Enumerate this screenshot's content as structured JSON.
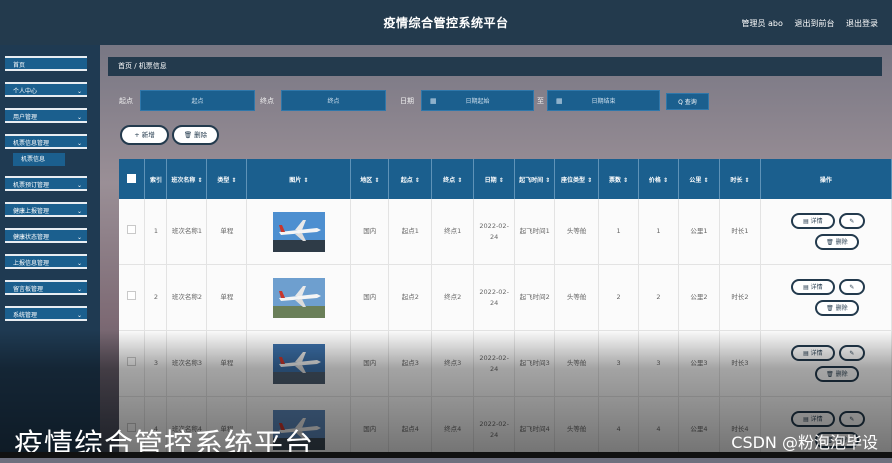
{
  "header": {
    "title": "疫情综合管控系统平台",
    "admin": "管理员 abo",
    "back": "退出到前台",
    "logout": "退出登录"
  },
  "sidebar": {
    "items": [
      {
        "label": "首页",
        "chevron": ""
      },
      {
        "label": "个人中心",
        "chevron": "⌄"
      },
      {
        "label": "用户管理",
        "chevron": "⌄"
      },
      {
        "label": "机票信息管理",
        "chevron": "⌄"
      },
      {
        "label": "机票预订管理",
        "chevron": "⌄"
      },
      {
        "label": "健康上报管理",
        "chevron": "⌄"
      },
      {
        "label": "健康状态管理",
        "chevron": "⌄"
      },
      {
        "label": "上报信息管理",
        "chevron": "⌄"
      },
      {
        "label": "留言板管理",
        "chevron": "⌄"
      },
      {
        "label": "系统管理",
        "chevron": "⌄"
      }
    ],
    "subitem": "机票信息"
  },
  "breadcrumb": "首页 / 机票信息",
  "search": {
    "from_label": "起点",
    "from_placeholder": "起点",
    "to_label": "终点",
    "to_placeholder": "终点",
    "date_label": "日期",
    "date_start": "日期起始",
    "range_sep": "至",
    "date_end": "日期结束",
    "query": "Q 查询"
  },
  "toolbar": {
    "add": "+ 新增",
    "delete": "🗑 删除"
  },
  "table": {
    "headers": [
      "",
      "索引",
      "班次名称 ⇕",
      "类型 ⇕",
      "图片 ⇕",
      "地区 ⇕",
      "起点 ⇕",
      "终点 ⇕",
      "日期 ⇕",
      "起飞时间 ⇕",
      "座位类型 ⇕",
      "票数 ⇕",
      "价格 ⇕",
      "公里 ⇕",
      "时长 ⇕",
      "操作"
    ],
    "rows": [
      {
        "idx": "1",
        "name": "班次名称1",
        "type": "单程",
        "region": "国内",
        "from": "起点1",
        "to": "终点1",
        "date": "2022-02-24",
        "time": "起飞时间1",
        "seat": "头等舱",
        "tickets": "1",
        "price": "1",
        "km": "公里1",
        "dur": "时长1"
      },
      {
        "idx": "2",
        "name": "班次名称2",
        "type": "单程",
        "region": "国内",
        "from": "起点2",
        "to": "终点2",
        "date": "2022-02-24",
        "time": "起飞时间2",
        "seat": "头等舱",
        "tickets": "2",
        "price": "2",
        "km": "公里2",
        "dur": "时长2"
      },
      {
        "idx": "3",
        "name": "班次名称3",
        "type": "单程",
        "region": "国内",
        "from": "起点3",
        "to": "终点3",
        "date": "2022-02-24",
        "time": "起飞时间3",
        "seat": "头等舱",
        "tickets": "3",
        "price": "3",
        "km": "公里3",
        "dur": "时长3"
      },
      {
        "idx": "4",
        "name": "班次名称4",
        "type": "单程",
        "region": "国内",
        "from": "起点4",
        "to": "终点4",
        "date": "2022-02-24",
        "time": "起飞时间4",
        "seat": "头等舱",
        "tickets": "4",
        "price": "4",
        "km": "公里4",
        "dur": "时长4"
      }
    ],
    "actions": {
      "detail": "▤ 详情",
      "edit": "✎",
      "delete": "🗑 删除"
    }
  },
  "watermark": {
    "left": "疫情综合管控系统平台",
    "right": "CSDN @粉泡泡毕设"
  },
  "colors": {
    "topbar": "#233a4d",
    "accent": "#1b5f8e"
  }
}
